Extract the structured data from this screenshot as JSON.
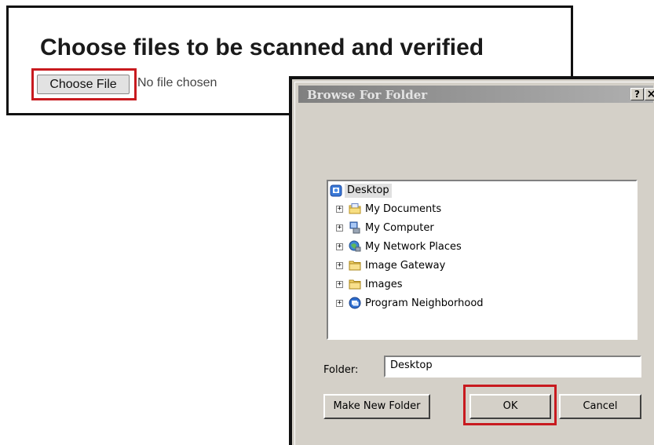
{
  "upload": {
    "title": "Choose files to be scanned and verified",
    "choose_button": "Choose File",
    "status_text": "No file chosen"
  },
  "dialog": {
    "title": "Browse For Folder",
    "help_button": "?",
    "close_button": "×",
    "tree": {
      "root": {
        "label": "Desktop",
        "icon": "desktop-icon"
      },
      "items": [
        {
          "label": "My Documents",
          "icon": "documents-icon"
        },
        {
          "label": "My Computer",
          "icon": "computer-icon"
        },
        {
          "label": "My Network Places",
          "icon": "network-icon"
        },
        {
          "label": "Image Gateway",
          "icon": "folder-icon"
        },
        {
          "label": "Images",
          "icon": "folder-icon"
        },
        {
          "label": "Program Neighborhood",
          "icon": "program-neighborhood-icon"
        }
      ],
      "expander_symbol": "+"
    },
    "folder_label": "Folder:",
    "folder_value": "Desktop",
    "buttons": {
      "make_new_folder": "Make New Folder",
      "ok": "OK",
      "cancel": "Cancel"
    }
  },
  "colors": {
    "highlight": "#c81a1f",
    "dialog_bg": "#d4d0c8"
  }
}
